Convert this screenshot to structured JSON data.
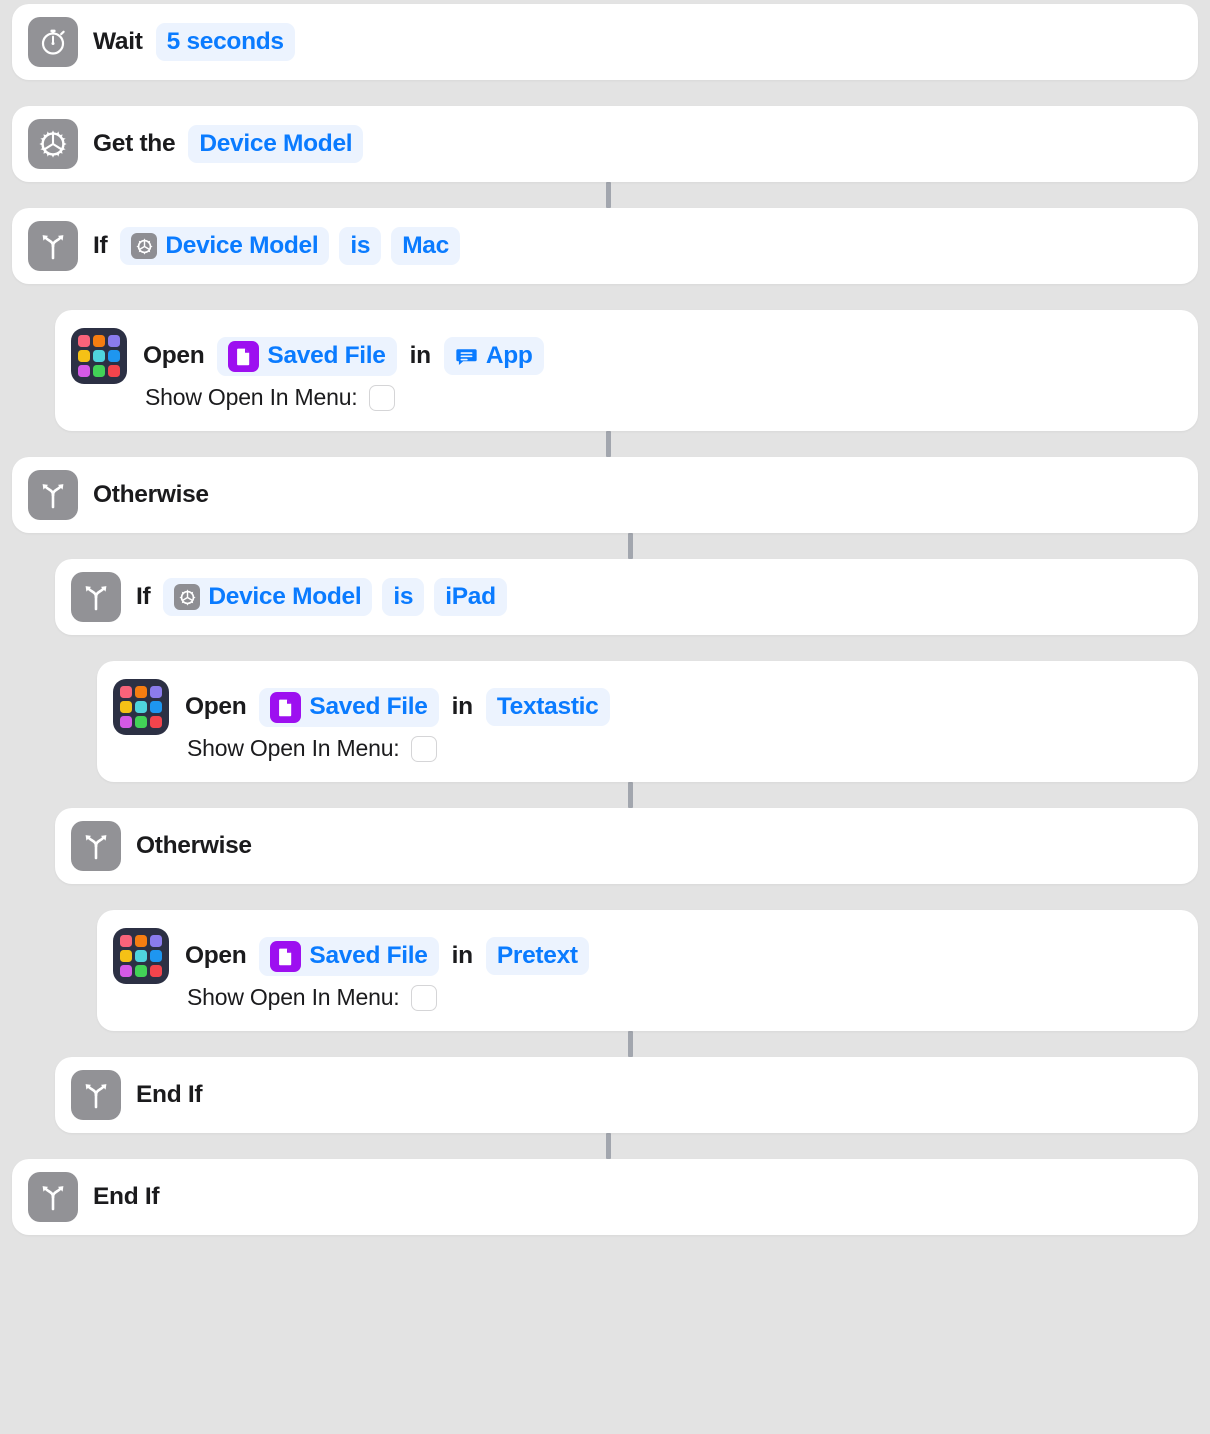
{
  "app": "Shortcuts workflow editor",
  "theme": {
    "background": "#e3e3e3",
    "card": "#ffffff",
    "accent_blue": "#0a7bff",
    "token_background": "#ecf3fe",
    "icon_gray": "#929296",
    "connector_gray": "#a2a6ae",
    "app_icon_background": "#2c3044",
    "doc_purple": "#9d0ff0"
  },
  "app_grid_colors": [
    "#f8637a",
    "#f57d11",
    "#8b7ced",
    "#f5c116",
    "#4fd4dd",
    "#1e96f0",
    "#d559e6",
    "#42d257",
    "#f3444c"
  ],
  "actions": [
    {
      "id": "wait",
      "level": 0,
      "icon": "stopwatch-icon",
      "label": "Wait",
      "token": "5 seconds"
    },
    {
      "id": "get-device-details",
      "level": 0,
      "icon": "gear-icon",
      "label": "Get the",
      "token": "Device Model"
    },
    {
      "id": "if-mac",
      "level": 0,
      "icon": "branch-icon",
      "label": "If",
      "variable_icon": "gear-chip-icon",
      "variable": "Device Model",
      "operator": "is",
      "value": "Mac"
    },
    {
      "id": "open-in-app",
      "level": 1,
      "icon": "app-grid-icon",
      "label": "Open",
      "file_icon": "document-chip-icon",
      "file": "Saved File",
      "connector_word": "in",
      "target_icon": "message-bubble-icon",
      "target": "App",
      "param_label": "Show Open In Menu:",
      "param_checked": false
    },
    {
      "id": "otherwise-outer",
      "level": 0,
      "icon": "branch-icon",
      "label": "Otherwise"
    },
    {
      "id": "if-ipad",
      "level": 1,
      "icon": "branch-icon",
      "label": "If",
      "variable_icon": "gear-chip-icon",
      "variable": "Device Model",
      "operator": "is",
      "value": "iPad"
    },
    {
      "id": "open-in-textastic",
      "level": 2,
      "icon": "app-grid-icon",
      "label": "Open",
      "file_icon": "document-chip-icon",
      "file": "Saved File",
      "connector_word": "in",
      "target": "Textastic",
      "param_label": "Show Open In Menu:",
      "param_checked": false
    },
    {
      "id": "otherwise-inner",
      "level": 1,
      "icon": "branch-icon",
      "label": "Otherwise"
    },
    {
      "id": "open-in-pretext",
      "level": 2,
      "icon": "app-grid-icon",
      "label": "Open",
      "file_icon": "document-chip-icon",
      "file": "Saved File",
      "connector_word": "in",
      "target": "Pretext",
      "param_label": "Show Open In Menu:",
      "param_checked": false
    },
    {
      "id": "end-if-inner",
      "level": 1,
      "icon": "branch-icon",
      "label": "End If"
    },
    {
      "id": "end-if-outer",
      "level": 0,
      "icon": "branch-icon",
      "label": "End If"
    }
  ]
}
